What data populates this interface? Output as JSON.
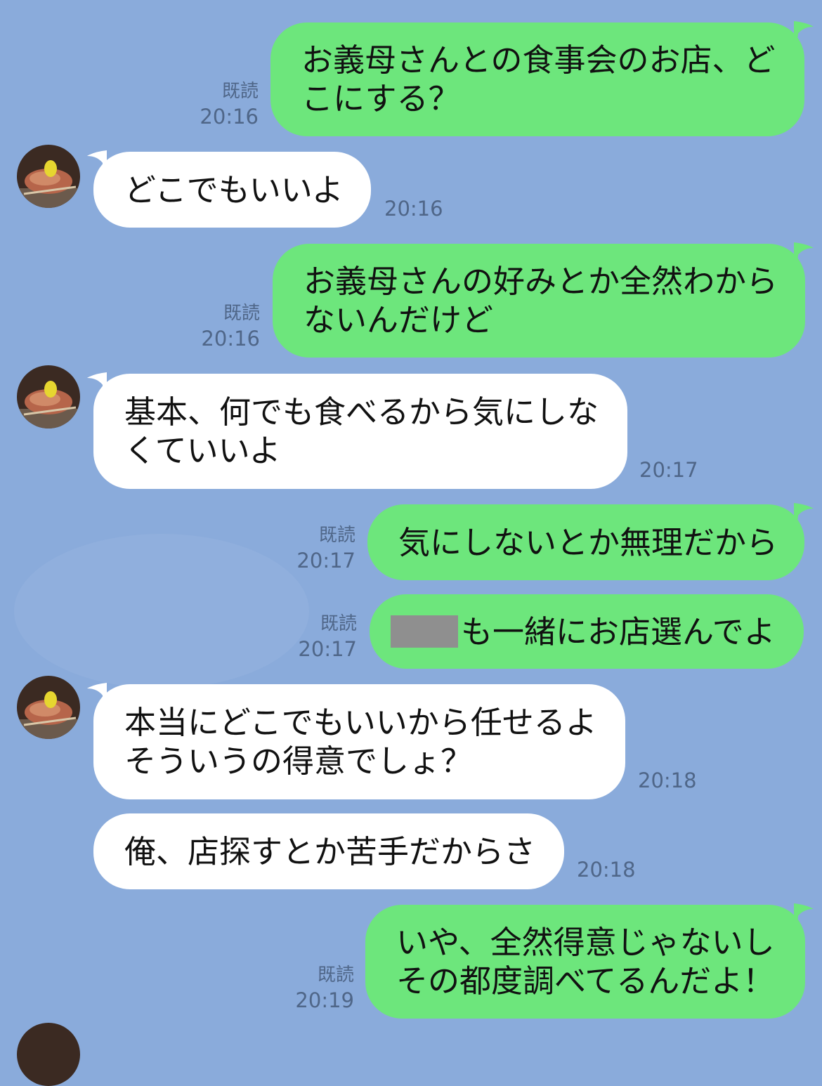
{
  "colors": {
    "background": "#8aabdb",
    "outgoing_bubble": "#6de67c",
    "incoming_bubble": "#ffffff",
    "meta_text": "#4f6688"
  },
  "messages": [
    {
      "side": "out",
      "lines": [
        "お義母さんとの食事会のお店、ど",
        "こにする？"
      ],
      "read": "既読",
      "time": "20:16"
    },
    {
      "side": "in",
      "lines": [
        "どこでもいいよ"
      ],
      "time": "20:16",
      "avatar": "yakitori-avatar"
    },
    {
      "side": "out",
      "lines": [
        "お義母さんの好みとか全然わから",
        "ないんだけど"
      ],
      "read": "既読",
      "time": "20:16"
    },
    {
      "side": "in",
      "lines": [
        "基本、何でも食べるから気にしな",
        "くていいよ"
      ],
      "time": "20:17",
      "avatar": "yakitori-avatar"
    },
    {
      "side": "out",
      "lines": [
        "気にしないとか無理だから"
      ],
      "read": "既読",
      "time": "20:17"
    },
    {
      "side": "out",
      "lines": [
        "も一緒にお店選んでよ"
      ],
      "read": "既読",
      "time": "20:17",
      "redacted_prefix": true
    },
    {
      "side": "in",
      "lines": [
        "本当にどこでもいいから任せるよ",
        "そういうの得意でしょ？"
      ],
      "time": "20:18",
      "avatar": "yakitori-avatar"
    },
    {
      "side": "in",
      "lines": [
        "俺、店探すとか苦手だからさ"
      ],
      "time": "20:18"
    },
    {
      "side": "out",
      "lines": [
        "いや、全然得意じゃないし",
        "その都度調べてるんだよ！"
      ],
      "read": "既読",
      "time": "20:19"
    }
  ]
}
